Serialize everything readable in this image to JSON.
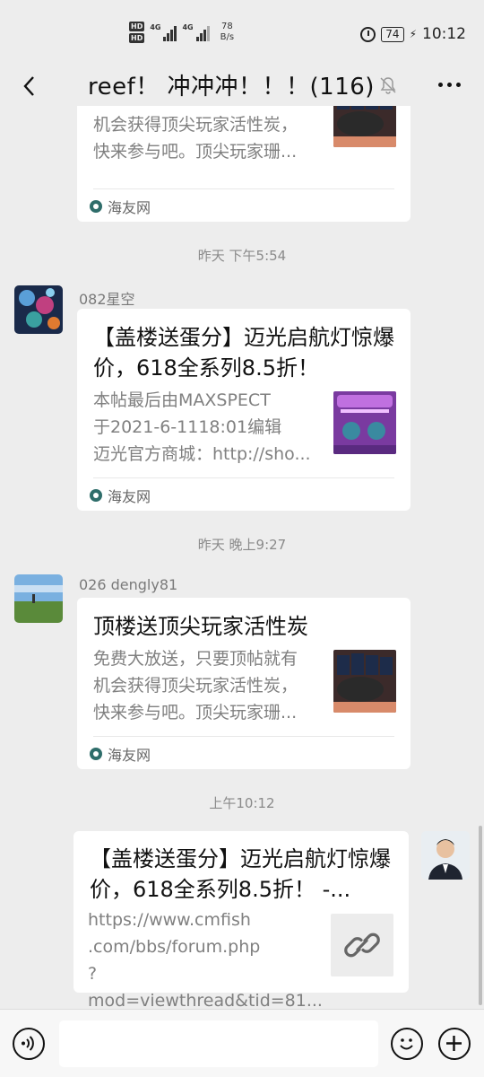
{
  "status_bar": {
    "hd_top": "HD",
    "hd_bottom": "HD",
    "net1": "4G",
    "net2": "4G",
    "speed_value": "78",
    "speed_unit": "B/s",
    "battery": "74",
    "time": "10:12",
    "alarm_icon": "alarm-clock-icon",
    "charging_icon": "lightning-bolt-icon"
  },
  "header": {
    "title": "reef！ 冲冲冲！！！(116)",
    "back_icon": "chevron-left-icon",
    "mute_icon": "bell-slash-icon",
    "more_icon": "more-dots-icon"
  },
  "messages": [
    {
      "type": "shared-card",
      "partial": true,
      "desc_lines": "免费大放送，只要顶帖就有\n机会获得顶尖玩家活性炭，\n快来参与吧。顶尖玩家珊...",
      "source": "海友网"
    },
    {
      "type": "timestamp",
      "text": "昨天 下午5:54"
    },
    {
      "type": "shared-card",
      "sender": "082星空",
      "title": "【盖楼送蛋分】迈光启航灯惊爆价，618全系列8.5折！",
      "desc_lines": "本帖最后由MAXSPECT\n于2021-6-1118:01编辑\n迈光官方商城：http://sho...",
      "source": "海友网"
    },
    {
      "type": "timestamp",
      "text": "昨天 晚上9:27"
    },
    {
      "type": "shared-card",
      "sender": "026 dengly81",
      "title": "顶楼送顶尖玩家活性炭",
      "desc_lines": "免费大放送，只要顶帖就有\n机会获得顶尖玩家活性炭，\n快来参与吧。顶尖玩家珊...",
      "source": "海友网"
    },
    {
      "type": "timestamp",
      "text": "上午10:12"
    },
    {
      "type": "link-card",
      "own": true,
      "title": "【盖楼送蛋分】迈光启航灯惊爆价，618全系列8.5折！ -...",
      "desc_lines": "https://www.cmfish\n.com/bbs/forum.php\n?mod=viewthread&tid=81...",
      "link_icon": "chain-link-icon"
    }
  ],
  "input_bar": {
    "voice_icon": "voice-icon",
    "emoji_icon": "emoji-icon",
    "plus_icon": "plus-icon",
    "input_value": ""
  },
  "colors": {
    "background": "#ededed",
    "card": "#ffffff",
    "source_icon": "#2e6d6a"
  }
}
